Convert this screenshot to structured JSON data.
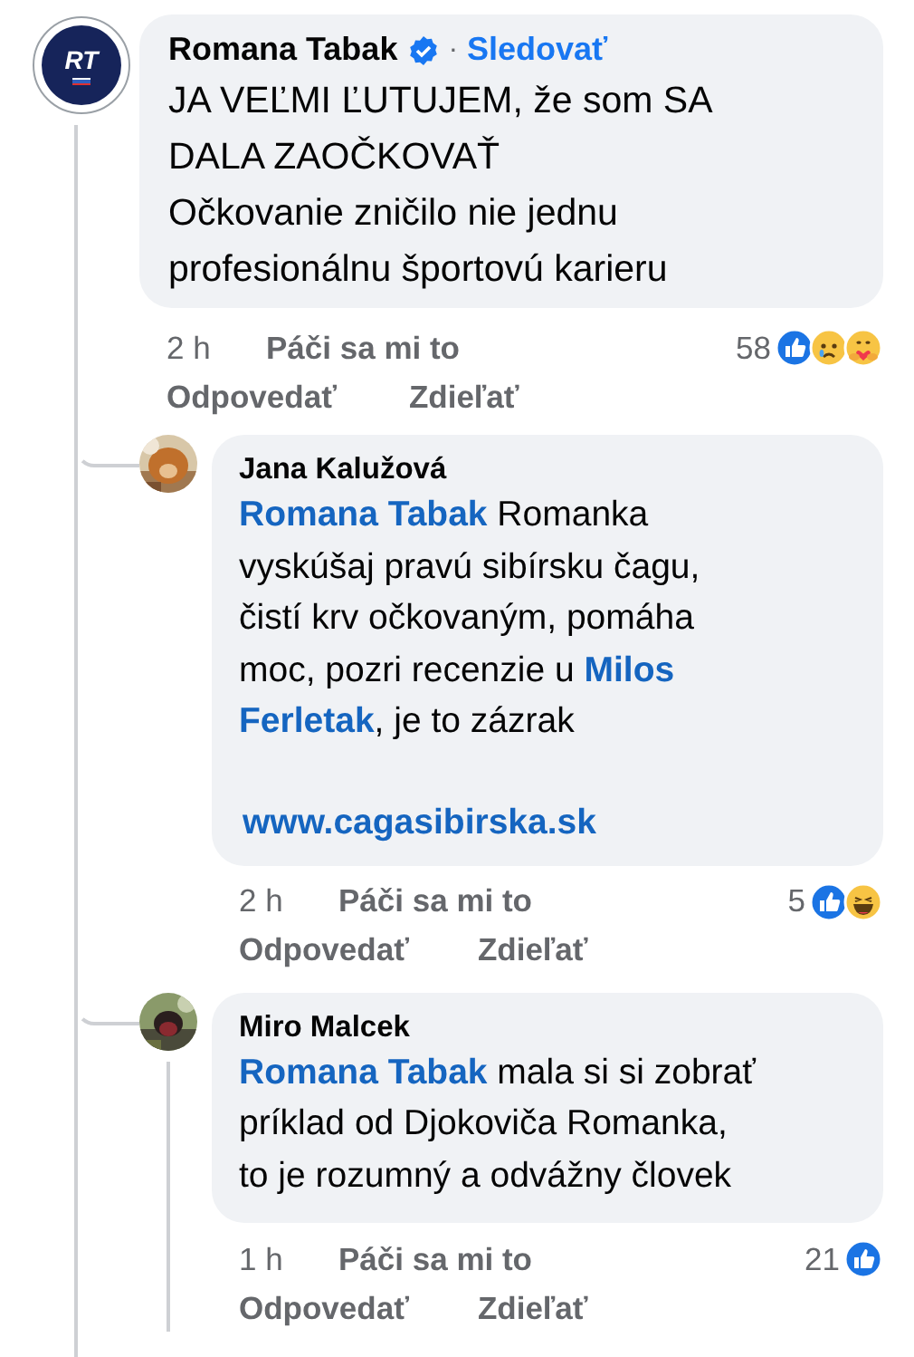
{
  "comment": {
    "author": {
      "name": "Romana Tabak",
      "verified": true,
      "avatar_initials": "RT"
    },
    "separator": "·",
    "follow": "Sledovať",
    "body": [
      [
        {
          "kind": "text",
          "text": "JA VEĽMI ĽUTUJEM, že som SA"
        }
      ],
      [
        {
          "kind": "text",
          "text": "DALA ZAOČKOVAŤ"
        }
      ],
      [
        {
          "kind": "text",
          "text": "Očkovanie zničilo nie jednu"
        }
      ],
      [
        {
          "kind": "text",
          "text": "profesionálnu športovú karieru"
        }
      ]
    ],
    "time": "2 h",
    "like": "Páči sa mi to",
    "reply": "Odpovedať",
    "share": "Zdieľať",
    "reaction_count": "58",
    "reactions": [
      {
        "kind": "like"
      },
      {
        "kind": "sad"
      },
      {
        "kind": "care"
      }
    ]
  },
  "replies": [
    {
      "author": {
        "name": "Jana Kalužová"
      },
      "avatar": {
        "kind": "picture"
      },
      "thread_line": false,
      "body": [
        [
          {
            "kind": "mention",
            "text": "Romana Tabak"
          },
          {
            "kind": "text",
            "text": " Romanka"
          }
        ],
        [
          {
            "kind": "text",
            "text": "vyskúšaj pravú  sibírsku čagu,"
          }
        ],
        [
          {
            "kind": "text",
            "text": "čistí krv očkovaným, pomáha"
          }
        ],
        [
          {
            "kind": "text",
            "text": "moc, pozri recenzie u "
          },
          {
            "kind": "mention",
            "text": "Milos"
          }
        ],
        [
          {
            "kind": "mention",
            "text": "Ferletak"
          },
          {
            "kind": "text",
            "text": ", je to zázrak"
          }
        ]
      ],
      "link": "www.cagasibirska.sk",
      "time": "2 h",
      "like": "Páči sa mi to",
      "reply": "Odpovedať",
      "share": "Zdieľať",
      "reaction_count": "5",
      "reactions": [
        {
          "kind": "like"
        },
        {
          "kind": "haha"
        }
      ]
    },
    {
      "author": {
        "name": "Miro Malcek"
      },
      "avatar": {
        "kind": "picture"
      },
      "thread_line": true,
      "body": [
        [
          {
            "kind": "mention",
            "text": "Romana Tabak"
          },
          {
            "kind": "text",
            "text": " mala si si zobrať"
          }
        ],
        [
          {
            "kind": "text",
            "text": "príklad od Djokoviča Romanka,"
          }
        ],
        [
          {
            "kind": "text",
            "text": "to je rozumný a odvážny človek"
          }
        ]
      ],
      "time": "1 h",
      "like": "Páči sa mi to",
      "reply": "Odpovedať",
      "share": "Zdieľať",
      "reaction_count": "21",
      "reactions": [
        {
          "kind": "like"
        }
      ]
    }
  ]
}
